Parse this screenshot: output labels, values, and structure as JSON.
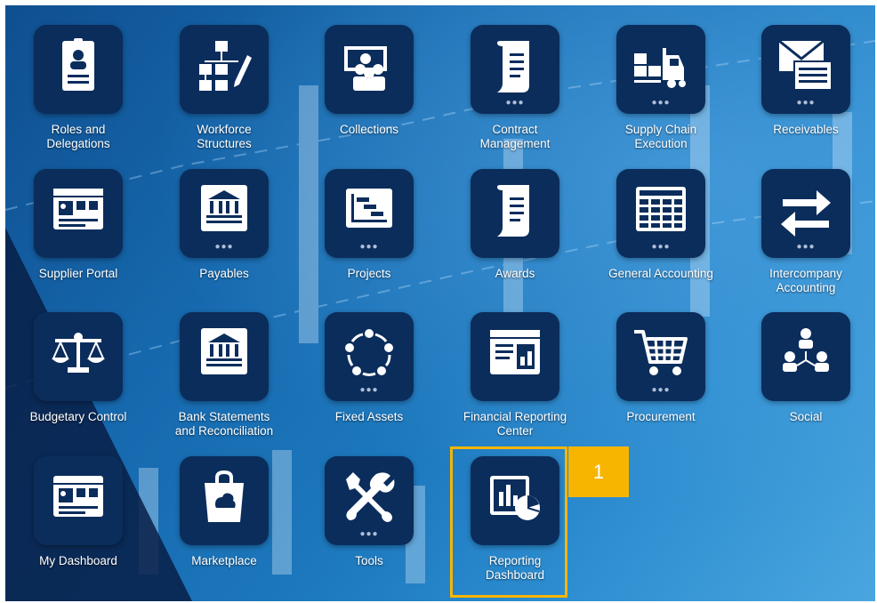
{
  "tiles": [
    {
      "label": "Roles and Delegations",
      "icon": "roles-delegations-icon",
      "dots": false
    },
    {
      "label": "Workforce Structures",
      "icon": "workforce-structures-icon",
      "dots": false
    },
    {
      "label": "Collections",
      "icon": "collections-icon",
      "dots": false
    },
    {
      "label": "Contract Management",
      "icon": "contract-management-icon",
      "dots": true
    },
    {
      "label": "Supply Chain Execution",
      "icon": "supply-chain-icon",
      "dots": true
    },
    {
      "label": "Receivables",
      "icon": "receivables-icon",
      "dots": true
    },
    {
      "label": "Supplier Portal",
      "icon": "supplier-portal-icon",
      "dots": false
    },
    {
      "label": "Payables",
      "icon": "payables-icon",
      "dots": true
    },
    {
      "label": "Projects",
      "icon": "projects-icon",
      "dots": true
    },
    {
      "label": "Awards",
      "icon": "awards-icon",
      "dots": false
    },
    {
      "label": "General Accounting",
      "icon": "general-accounting-icon",
      "dots": true
    },
    {
      "label": "Intercompany Accounting",
      "icon": "intercompany-icon",
      "dots": true
    },
    {
      "label": "Budgetary Control",
      "icon": "budgetary-control-icon",
      "dots": false
    },
    {
      "label": "Bank Statements and Reconciliation",
      "icon": "bank-statements-icon",
      "dots": false
    },
    {
      "label": "Fixed Assets",
      "icon": "fixed-assets-icon",
      "dots": true
    },
    {
      "label": "Financial Reporting Center",
      "icon": "financial-reporting-icon",
      "dots": false
    },
    {
      "label": "Procurement",
      "icon": "procurement-icon",
      "dots": true
    },
    {
      "label": "Social",
      "icon": "social-icon",
      "dots": false
    },
    {
      "label": "My Dashboard",
      "icon": "dashboard-icon",
      "dots": false
    },
    {
      "label": "Marketplace",
      "icon": "marketplace-icon",
      "dots": false
    },
    {
      "label": "Tools",
      "icon": "tools-icon",
      "dots": true
    },
    {
      "label": "Reporting Dashboard",
      "icon": "reporting-dashboard-icon",
      "dots": false
    }
  ],
  "callout": {
    "number": "1"
  },
  "colors": {
    "tile": "#0b2d5c",
    "highlight": "#f7b500",
    "icon": "#ffffff"
  }
}
